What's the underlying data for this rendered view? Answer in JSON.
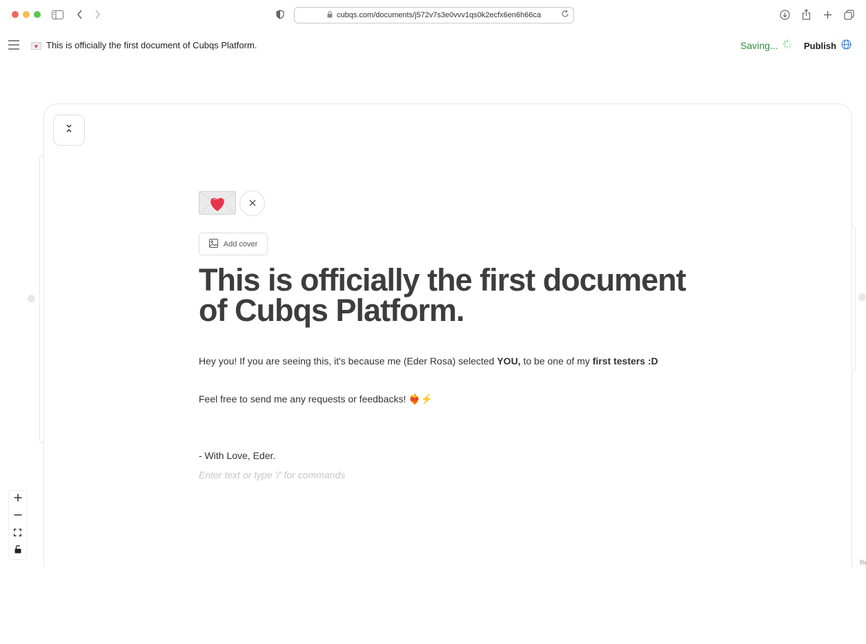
{
  "browser": {
    "url": "cubqs.com/documents/j572v7s3e0vvv1qs0k2ecfx6en6h66ca",
    "icons": [
      "sidebar-icon",
      "back-icon",
      "forward-icon",
      "shield-icon",
      "lock-icon",
      "reload-icon",
      "download-icon",
      "share-icon",
      "new-tab-icon",
      "tabs-overview-icon"
    ]
  },
  "header": {
    "doc_title": "This is officially the first document of Cubqs Platform.",
    "status": "Saving...",
    "publish_label": "Publish",
    "accent": "#2f8f3a"
  },
  "document": {
    "add_cover_label": "Add cover",
    "title": "This is officially the first document of Cubqs Platform.",
    "p1_a": "Hey you! If you are seeing this, it's because me (Eder Rosa) selected ",
    "p1_b": "YOU,",
    "p1_c": " to be one of my ",
    "p1_d": "first testers :D",
    "p2": "Feel free to send me any requests or feedbacks! ❤️‍🔥⚡",
    "p3": "- With Love, Eder.",
    "placeholder": "Enter text or type '/' for commands"
  },
  "corner_text": "Re"
}
